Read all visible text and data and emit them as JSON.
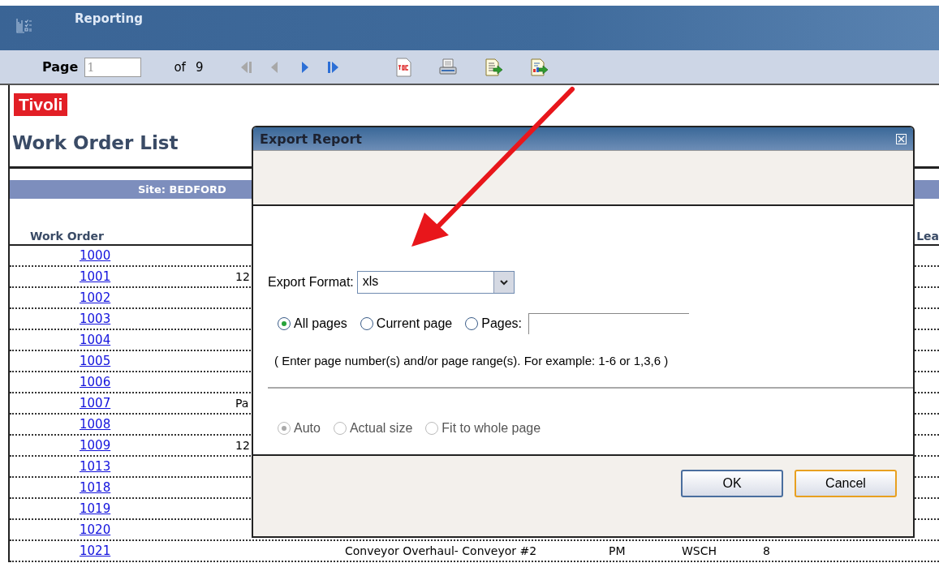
{
  "header": {
    "title": "Reporting"
  },
  "toolbar": {
    "page_label": "Page",
    "page_value": "1",
    "of_label": "of",
    "page_count": "9",
    "nav": [
      {
        "kind": "first",
        "disabled": true
      },
      {
        "kind": "prev",
        "disabled": true
      },
      {
        "kind": "next",
        "disabled": false
      },
      {
        "kind": "last",
        "disabled": false
      }
    ],
    "tools": [
      {
        "kind": "toc"
      },
      {
        "kind": "print"
      },
      {
        "kind": "export"
      },
      {
        "kind": "export-report"
      }
    ]
  },
  "report": {
    "logo": "Tivoli",
    "title": "Work Order List",
    "site_band": "Site: BEDFORD",
    "columns": [
      {
        "label": "Work Order"
      },
      {
        "label": "Lea"
      }
    ],
    "rows": [
      {
        "work_order": "1000"
      },
      {
        "work_order": "1001",
        "column_2": "12"
      },
      {
        "work_order": "1002"
      },
      {
        "work_order": "1003"
      },
      {
        "work_order": "1004"
      },
      {
        "work_order": "1005"
      },
      {
        "work_order": "1006"
      },
      {
        "work_order": "1007",
        "column_2": "Pa"
      },
      {
        "work_order": "1008"
      },
      {
        "work_order": "1009",
        "column_2": "12"
      },
      {
        "work_order": "1013"
      },
      {
        "work_order": "1018"
      },
      {
        "work_order": "1019"
      },
      {
        "work_order": "1020"
      },
      {
        "work_order": "1021",
        "description": "Conveyor Overhaul- Conveyor #2",
        "type": "PM",
        "status": "WSCH",
        "column_6": "8"
      }
    ]
  },
  "dialog": {
    "title": "Export Report",
    "format_label": "Export Format:",
    "format_value": "xls",
    "page_options": [
      {
        "label": "All pages",
        "selected": true
      },
      {
        "label": "Current page",
        "selected": false
      },
      {
        "label": "Pages:",
        "selected": false,
        "kind": "with-field"
      }
    ],
    "hint": "( Enter page number(s) and/or page range(s). For example: 1-6 or 1,3,6 )",
    "scale_options": [
      {
        "label": "Auto",
        "selected": true,
        "disabled": true
      },
      {
        "label": "Actual size",
        "selected": false,
        "disabled": true
      },
      {
        "label": "Fit to whole page",
        "selected": false,
        "disabled": true
      }
    ],
    "buttons": [
      {
        "label": "OK",
        "focused": false
      },
      {
        "label": "Cancel",
        "focused": true
      }
    ]
  }
}
